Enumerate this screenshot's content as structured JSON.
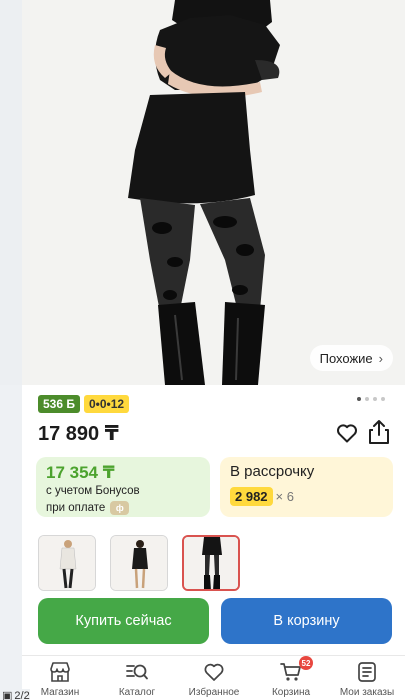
{
  "gallery": {
    "similar_label": "Похожие",
    "dots_count": 4,
    "active_dot": 0,
    "page_indicator": "2/2"
  },
  "product": {
    "bonus_badge": "536 Б",
    "plan_badge": "0•0•12",
    "price": "17 890 ₸",
    "thumbnails_count": 3,
    "selected_thumbnail": 2
  },
  "bonus_card": {
    "price": "17 354 ₸",
    "line1": "с учетом Бонусов",
    "line2": "при оплате",
    "coin_symbol": "ф"
  },
  "installment_card": {
    "title": "В рассрочку",
    "amount": "2 982",
    "multiplier": "× 6"
  },
  "actions": {
    "buy_now": "Купить сейчас",
    "add_to_cart": "В корзину"
  },
  "nav": {
    "items": [
      {
        "label": "Магазин",
        "icon": "store-icon"
      },
      {
        "label": "Каталог",
        "icon": "catalog-search-icon"
      },
      {
        "label": "Избранное",
        "icon": "heart-icon"
      },
      {
        "label": "Корзина",
        "icon": "cart-icon"
      },
      {
        "label": "Мои заказы",
        "icon": "orders-icon"
      }
    ],
    "cart_count": "52"
  },
  "colors": {
    "buy_green": "#45a847",
    "cart_blue": "#2e74c9",
    "bonus_green": "#4ca32e",
    "plan_yellow": "#ffd93d"
  }
}
